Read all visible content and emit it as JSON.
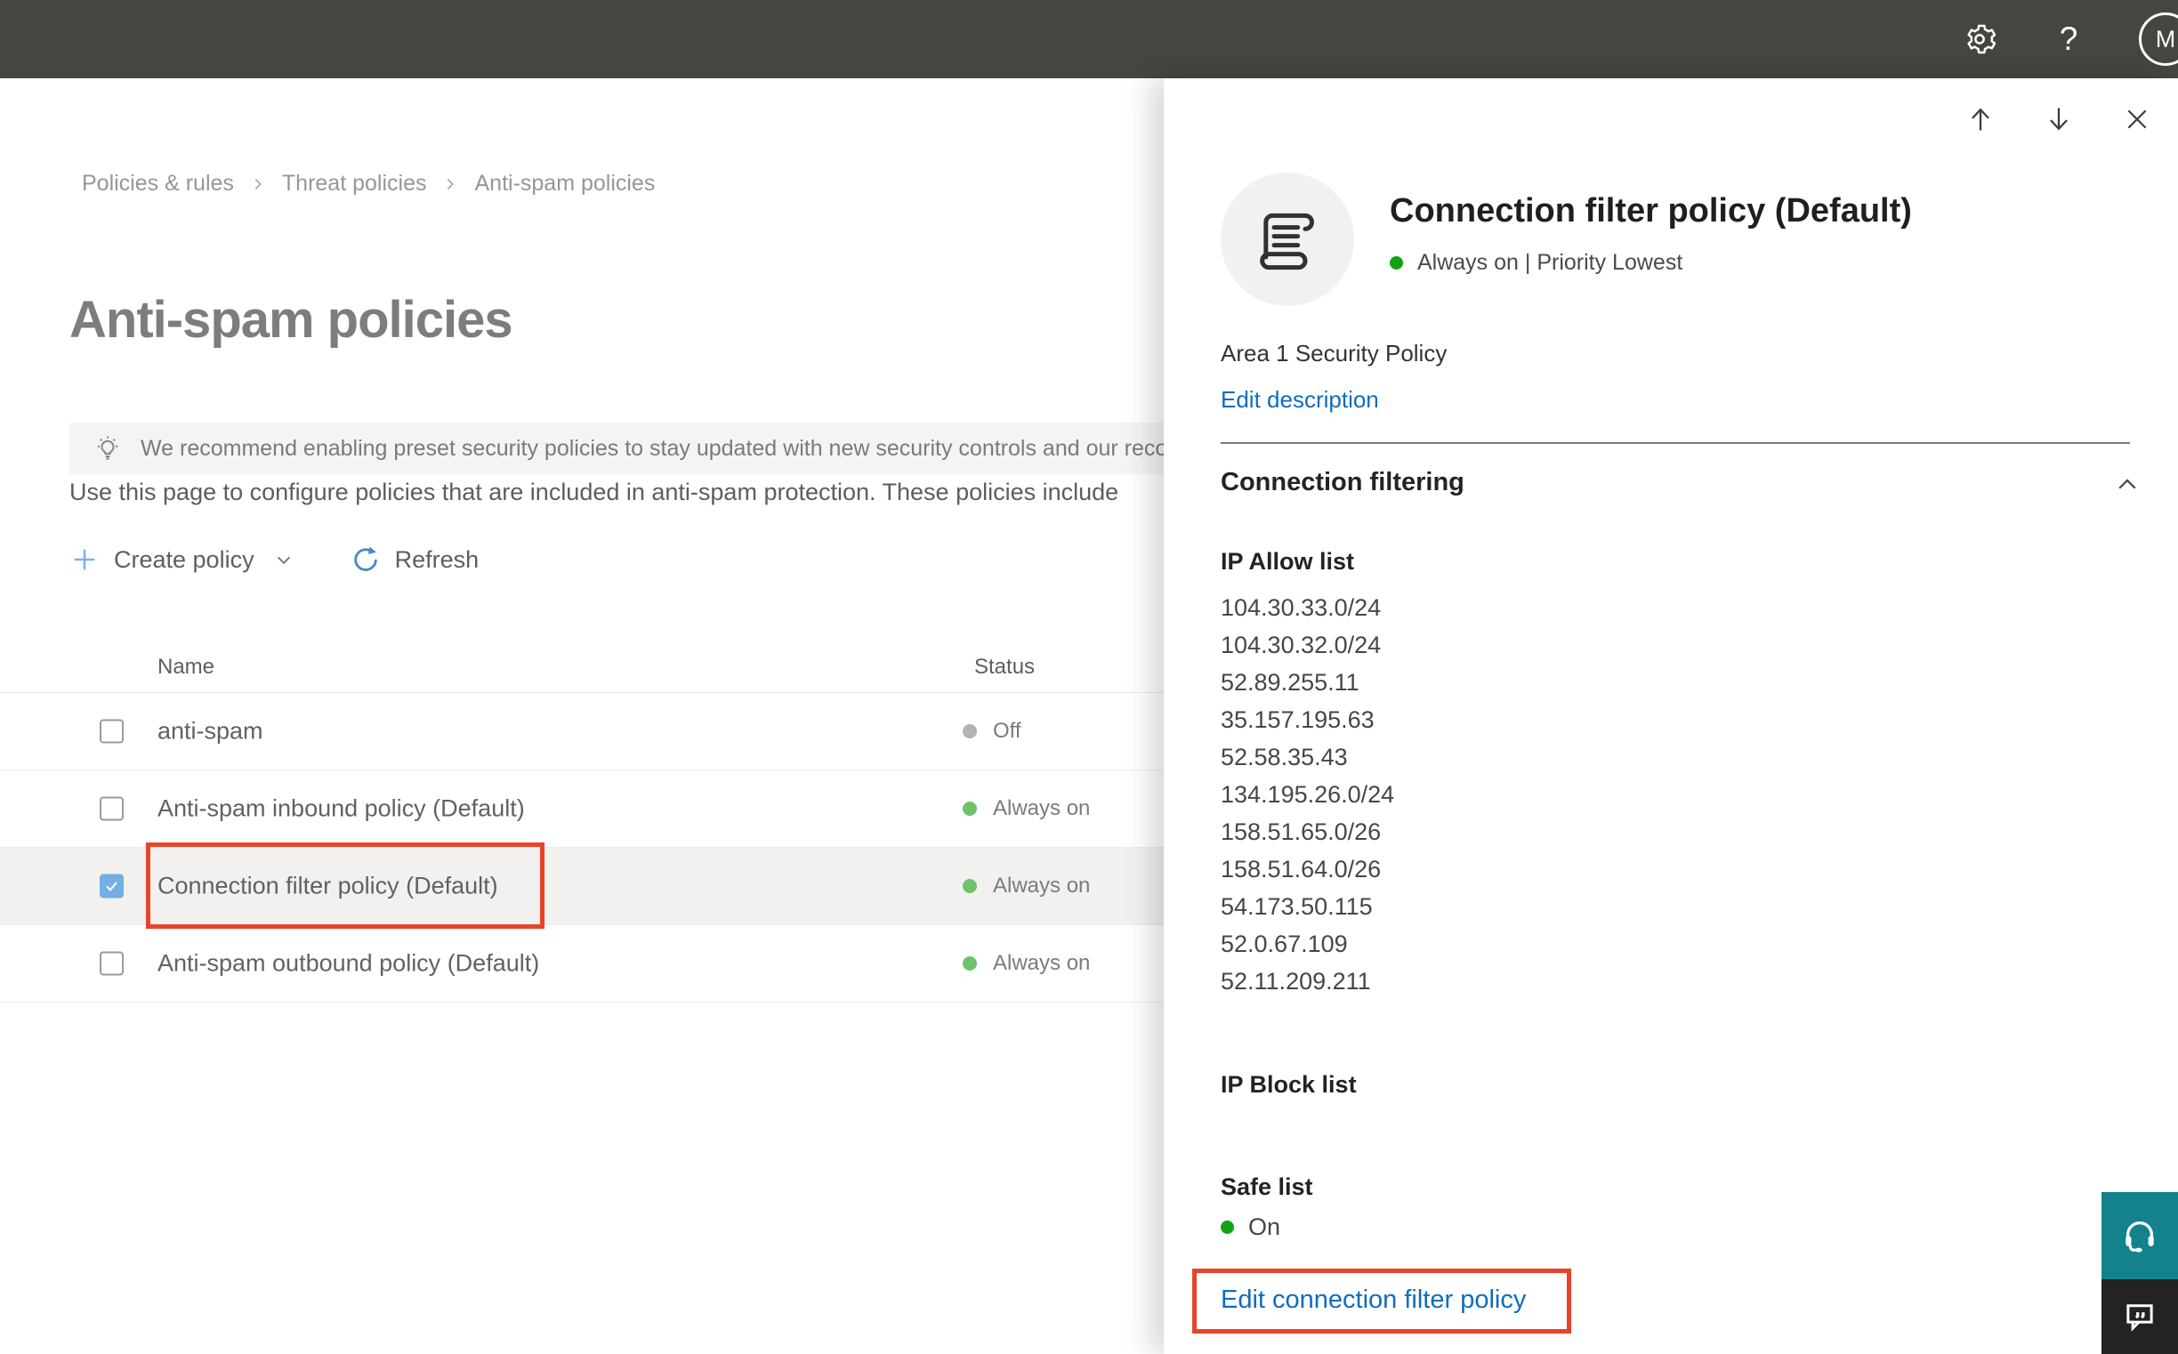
{
  "topbar": {
    "help_label": "?",
    "avatar_initial": "M"
  },
  "breadcrumb": {
    "items": [
      "Policies & rules",
      "Threat policies",
      "Anti-spam policies"
    ]
  },
  "page": {
    "title": "Anti-spam policies",
    "banner_text": "We recommend enabling preset security policies to stay updated with new security controls and our recomme",
    "intro_text": "Use this page to configure policies that are included in anti-spam protection. These policies include",
    "toolbar": {
      "create_label": "Create policy",
      "refresh_label": "Refresh"
    }
  },
  "table": {
    "columns": {
      "name": "Name",
      "status": "Status"
    },
    "rows": [
      {
        "name": "anti-spam",
        "status": "Off",
        "status_level": "off",
        "checked": false,
        "selected": false
      },
      {
        "name": "Anti-spam inbound policy (Default)",
        "status": "Always on",
        "status_level": "on",
        "checked": false,
        "selected": false
      },
      {
        "name": "Connection filter policy (Default)",
        "status": "Always on",
        "status_level": "on",
        "checked": true,
        "selected": true,
        "highlighted": true
      },
      {
        "name": "Anti-spam outbound policy (Default)",
        "status": "Always on",
        "status_level": "on",
        "checked": false,
        "selected": false
      }
    ]
  },
  "flyout": {
    "title": "Connection filter policy (Default)",
    "status_line": "Always on | Priority Lowest",
    "description": "Area 1 Security Policy",
    "edit_description_label": "Edit description",
    "section_title": "Connection filtering",
    "ip_allow": {
      "heading": "IP Allow list",
      "items": [
        "104.30.33.0/24",
        "104.30.32.0/24",
        "52.89.255.11",
        "35.157.195.63",
        "52.58.35.43",
        "134.195.26.0/24",
        "158.51.65.0/26",
        "158.51.64.0/26",
        "54.173.50.115",
        "52.0.67.109",
        "52.11.209.211"
      ]
    },
    "ip_block": {
      "heading": "IP Block list"
    },
    "safe_list": {
      "heading": "Safe list",
      "value": "On"
    },
    "edit_link_label": "Edit connection filter policy"
  },
  "icons": {
    "topbar": [
      "settings-gear-icon",
      "help-icon",
      "avatar"
    ],
    "banner": "lightbulb-icon",
    "toolbar": [
      "plus-icon",
      "chevron-down-icon",
      "refresh-icon"
    ],
    "flyout": [
      "arrow-up-icon",
      "arrow-down-icon",
      "close-icon",
      "scroll-policy-icon",
      "chevron-up-icon"
    ],
    "floating": [
      "headset-icon",
      "feedback-chat-icon"
    ]
  },
  "colors": {
    "topbar_bg": "#474540",
    "accent_link_blue": "#0f6cbd",
    "highlight_red": "#e8442a",
    "status_green": "#6dc36d",
    "status_green_bright": "#11a311",
    "status_gray": "#b5b2af",
    "checkbox_checked_blue": "#71afe5",
    "selected_row_bg": "#f2f1f0",
    "support_teal": "#13828c",
    "feedback_dark": "#242322"
  }
}
